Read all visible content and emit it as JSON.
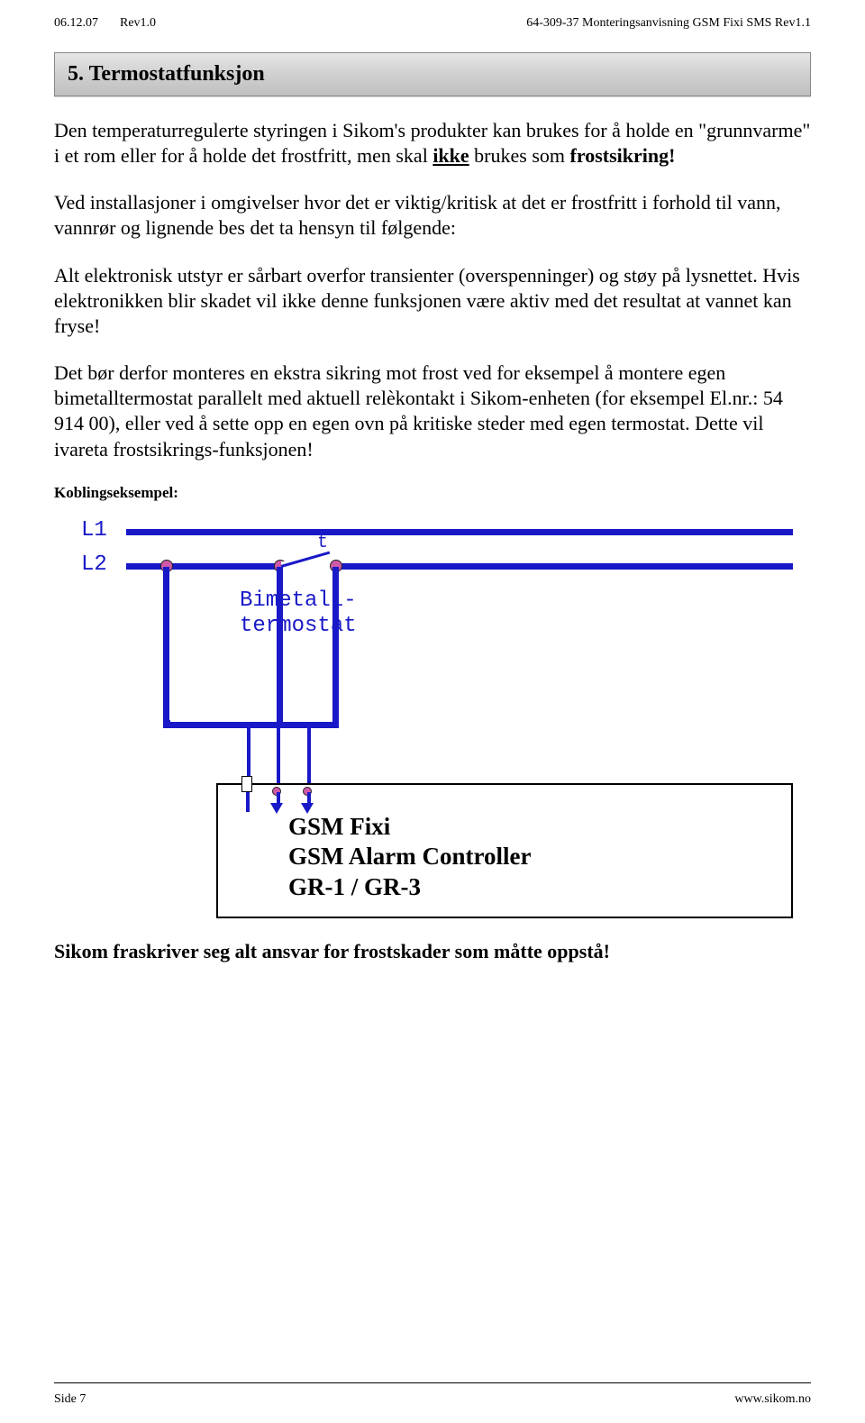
{
  "header": {
    "date": "06.12.07",
    "rev_left": "Rev1.0",
    "title_right": "64-309-37 Monteringsanvisning GSM Fixi SMS Rev1.1"
  },
  "section": {
    "number_title": "5.  Termostatfunksjon"
  },
  "paragraphs": {
    "p1_pre": "Den temperaturregulerte styringen i Sikom's produkter kan brukes for å holde en \"grunnvarme\" i et rom eller for å holde det frostfritt, men skal ",
    "p1_emph": "ikke",
    "p1_post": " brukes som ",
    "p1_tail": "frostsikring!",
    "p2": "Ved installasjoner i omgivelser hvor det er viktig/kritisk at det er frostfritt i forhold til vann, vannrør og lignende bes det ta hensyn til følgende:",
    "p3": "Alt elektronisk utstyr er sårbart overfor transienter (overspenninger) og støy på lysnettet. Hvis elektronikken blir skadet vil ikke denne funksjonen være aktiv med det resultat at vannet kan fryse!",
    "p4": "Det bør derfor monteres en ekstra sikring mot frost ved for eksempel å montere egen bimetalltermostat parallelt med aktuell relèkontakt i Sikom-enheten (for eksempel El.nr.: 54 914 00), eller ved å sette opp en egen ovn på kritiske steder med egen termostat. Dette vil ivareta frostsikrings-funksjonen!"
  },
  "sub_heading": "Koblingseksempel:",
  "diagram": {
    "l1": "L1",
    "l2": "L2",
    "t": "t",
    "thermostat_l1": "Bimetall-",
    "thermostat_l2": "termostat",
    "device_l1": "GSM Fixi",
    "device_l2": "GSM Alarm Controller",
    "device_l3": "GR-1 / GR-3"
  },
  "disclaimer": "Sikom fraskriver seg alt ansvar for frostskader som måtte oppstå!",
  "footer": {
    "left": "Side 7",
    "right": "www.sikom.no"
  }
}
